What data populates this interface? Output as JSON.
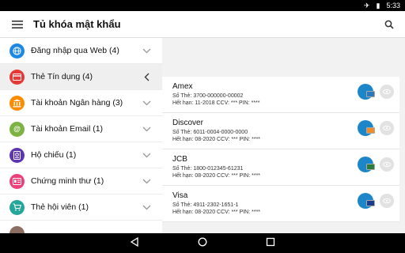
{
  "status": {
    "time": "5:33",
    "icons": [
      "airplane-icon",
      "battery-icon"
    ]
  },
  "appbar": {
    "title": "Tủ khóa mật khẩu",
    "menu_icon": "hamburger-icon",
    "search_icon": "search-icon"
  },
  "categories": [
    {
      "label": "Đăng nhập qua Web (4)",
      "icon": "globe-icon",
      "color": "#1e88e5",
      "expanded": false
    },
    {
      "label": "Thẻ Tín dụng (4)",
      "icon": "credit-card-icon",
      "color": "#e53935",
      "expanded": true
    },
    {
      "label": "Tài khoản Ngân hàng (3)",
      "icon": "bank-icon",
      "color": "#fb8c00",
      "expanded": false
    },
    {
      "label": "Tài khoản Email (1)",
      "icon": "at-icon",
      "color": "#7cb342",
      "expanded": false
    },
    {
      "label": "Hộ chiếu (1)",
      "icon": "passport-icon",
      "color": "#5e35b1",
      "expanded": false
    },
    {
      "label": "Chứng minh thư (1)",
      "icon": "id-card-icon",
      "color": "#ec407a",
      "expanded": false
    },
    {
      "label": "Thẻ hội viên (1)",
      "icon": "cart-icon",
      "color": "#26a69a",
      "expanded": false
    }
  ],
  "entries": [
    {
      "name": "Amex",
      "number": "Số Thẻ: 3700-000000-00002",
      "details": "Hết hạn: 11-2018 CCV: *** PIN: ****",
      "brand_color": "#2e77bb"
    },
    {
      "name": "Discover",
      "number": "Số Thẻ: 6011-0004-0000-0000",
      "details": "Hết hạn: 08-2020 CCV: *** PIN: ****",
      "brand_color": "#f28c28"
    },
    {
      "name": "JCB",
      "number": "Số Thẻ: 1800-012345-61231",
      "details": "Hết hạn: 08-2020 CCV: *** PIN: ****",
      "brand_color": "#2b7b3c"
    },
    {
      "name": "Visa",
      "number": "Số Thẻ: 4911-2302-1651-1",
      "details": "Hết hạn: 08-2020 CCV: *** PIN: ****",
      "brand_color": "#1a3c8f"
    }
  ],
  "fab": {
    "label": "+"
  }
}
